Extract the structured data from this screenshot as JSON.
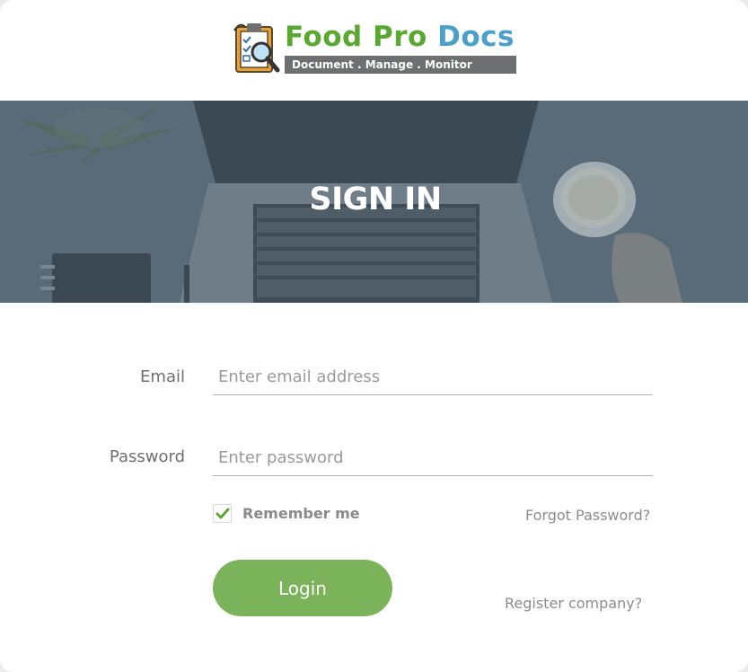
{
  "logo": {
    "title_part1": "Food Pro",
    "title_part2": "Docs",
    "tagline": "Document . Manage . Monitor"
  },
  "banner": {
    "title": "SIGN IN"
  },
  "form": {
    "email_label": "Email",
    "email_placeholder": "Enter email address",
    "email_value": "",
    "password_label": "Password",
    "password_placeholder": "Enter password",
    "password_value": "",
    "remember_label": "Remember me",
    "remember_checked": true,
    "forgot_label": "Forgot Password?",
    "login_label": "Login",
    "register_label": "Register company?"
  },
  "colors": {
    "brand_green": "#7bb35a",
    "logo_blue": "#4aa0c8",
    "checkmark": "#5aa832"
  }
}
